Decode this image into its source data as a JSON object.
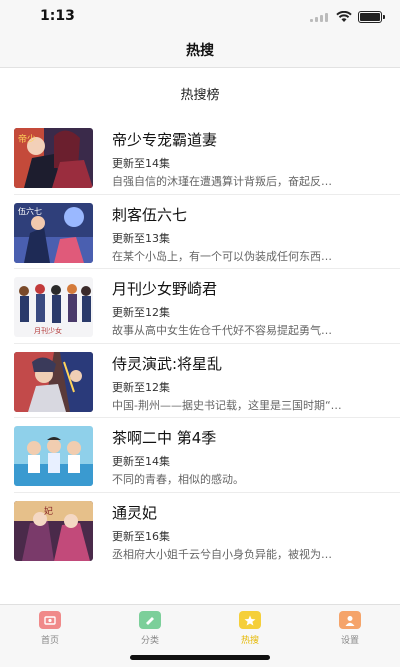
{
  "status_bar": {
    "time": "1:13"
  },
  "nav": {
    "title": "热搜"
  },
  "section": {
    "title": "热搜榜"
  },
  "items": [
    {
      "title": "帝少专宠霸道妻",
      "update": "更新至14集",
      "desc": "自强自信的沐瑾在遭遇算计背叛后，奋起反…"
    },
    {
      "title": "刺客伍六七",
      "update": "更新至13集",
      "desc": "在某个小岛上，有一个可以伪装成任何东西…"
    },
    {
      "title": "月刊少女野崎君",
      "update": "更新至12集",
      "desc": "故事从高中女生佐仓千代好不容易提起勇气…"
    },
    {
      "title": "侍灵演武:将星乱",
      "update": "更新至12集",
      "desc": "中国-荆州——据史书记载，这里是三国时期“…"
    },
    {
      "title": "茶啊二中 第4季",
      "update": "更新至14集",
      "desc": "不同的青春，相似的感动。"
    },
    {
      "title": "通灵妃",
      "update": "更新至16集",
      "desc": "丞相府大小姐千云兮自小身负异能，被视为…"
    }
  ],
  "tabs": [
    {
      "label": "首页",
      "icon": "home-icon",
      "color": "#f08a8a"
    },
    {
      "label": "分类",
      "icon": "category-icon",
      "color": "#7ccf9a"
    },
    {
      "label": "热搜",
      "icon": "hot-icon",
      "color": "#f5cf3a"
    },
    {
      "label": "设置",
      "icon": "settings-icon",
      "color": "#f5a46a"
    }
  ],
  "colors": {
    "accent": "#e6b800",
    "background": "#f7f7f7"
  }
}
